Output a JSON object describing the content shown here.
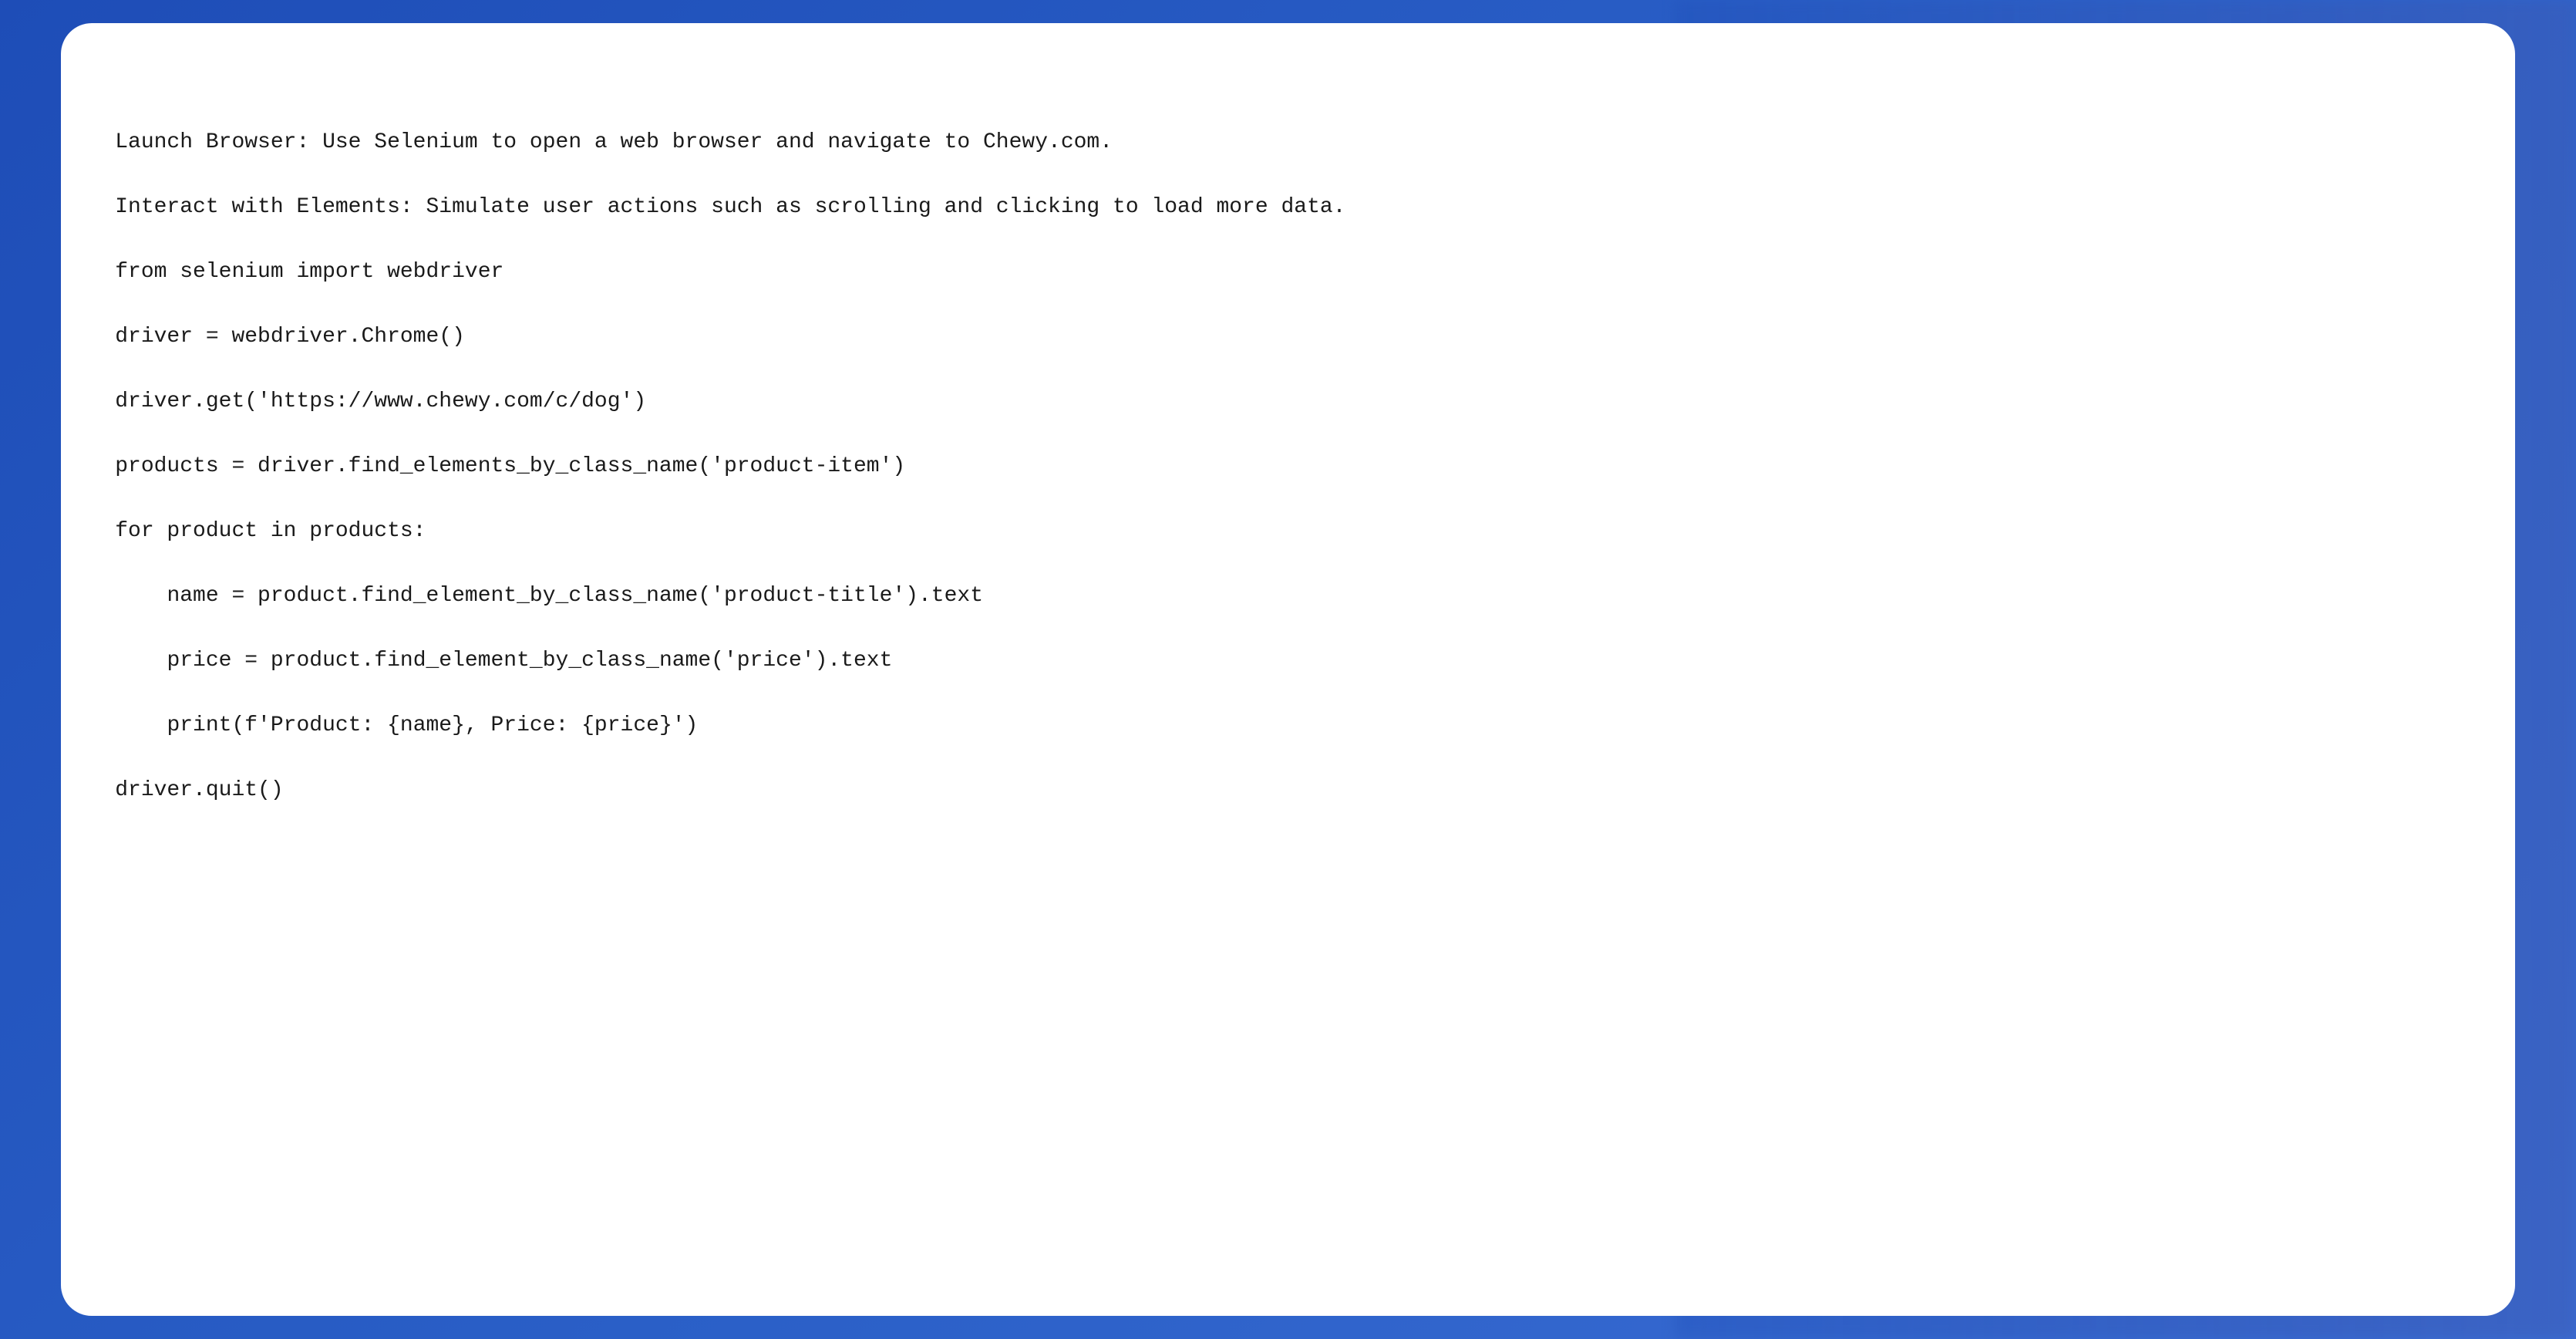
{
  "code": {
    "lines": [
      "Launch Browser: Use Selenium to open a web browser and navigate to Chewy.com.",
      "",
      "Interact with Elements: Simulate user actions such as scrolling and clicking to load more data.",
      "",
      "from selenium import webdriver",
      "",
      "driver = webdriver.Chrome()",
      "",
      "driver.get('https://www.chewy.com/c/dog')",
      "",
      "products = driver.find_elements_by_class_name('product-item')",
      "",
      "for product in products:",
      "",
      "    name = product.find_element_by_class_name('product-title').text",
      "",
      "    price = product.find_element_by_class_name('price').text",
      "",
      "    print(f'Product: {name}, Price: {price}')",
      "",
      "driver.quit()"
    ]
  }
}
